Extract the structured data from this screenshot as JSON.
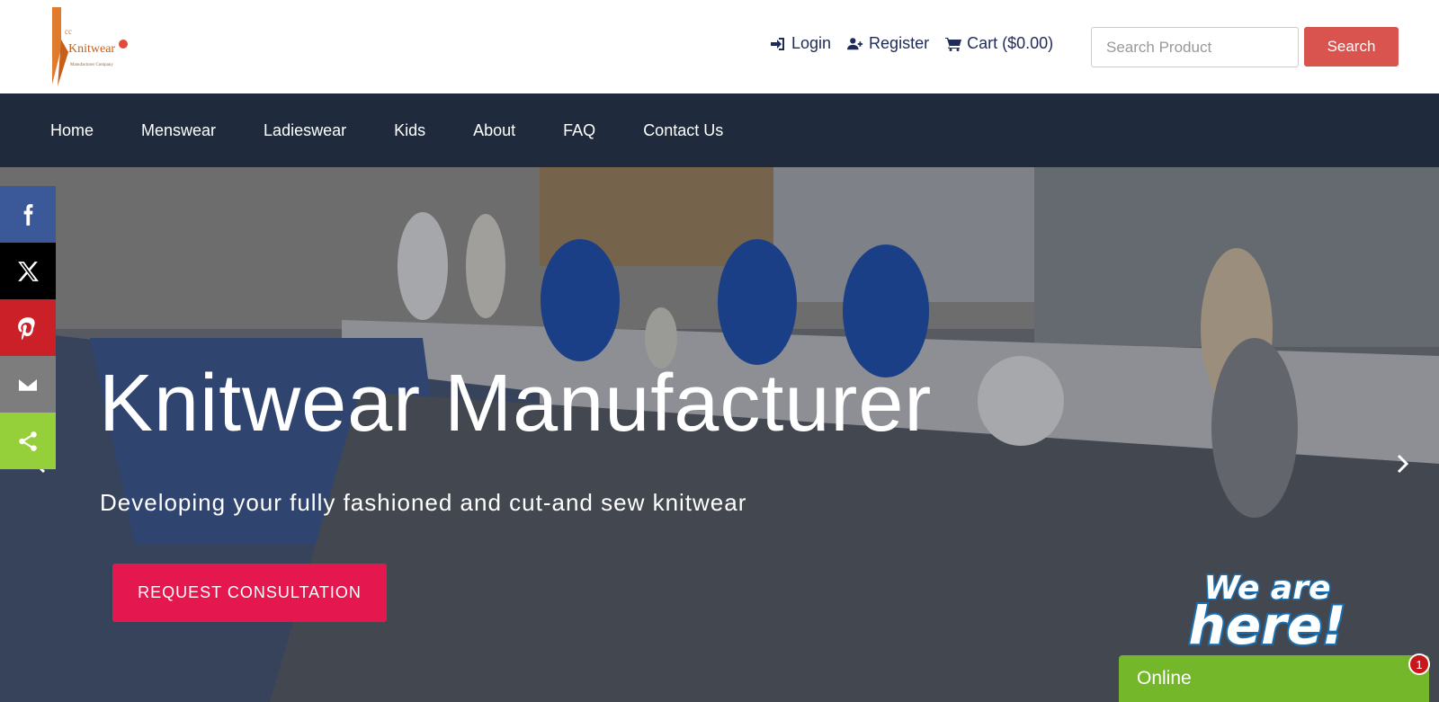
{
  "header": {
    "logo_text": "Knitwear",
    "logo_sub": "Manufacturer Company",
    "logo_initials": "cc",
    "links": [
      {
        "label": "Login",
        "icon": "login-icon"
      },
      {
        "label": "Register",
        "icon": "user-plus-icon"
      },
      {
        "label": "Cart ($0.00)",
        "icon": "cart-icon"
      }
    ],
    "search_placeholder": "Search Product",
    "search_label": "Search"
  },
  "nav": {
    "items": [
      "Home",
      "Menswear",
      "Ladieswear",
      "Kids",
      "About",
      "FAQ",
      "Contact Us"
    ]
  },
  "hero": {
    "title": "Knitwear Manufacturer",
    "subtitle": "Developing your fully fashioned and cut-and sew knitwear",
    "cta_label": "REQUEST CONSULTATION"
  },
  "social": [
    {
      "name": "facebook-icon",
      "color": "#3b5998"
    },
    {
      "name": "x-icon",
      "color": "#000000"
    },
    {
      "name": "pinterest-icon",
      "color": "#cb2027"
    },
    {
      "name": "email-icon",
      "color": "#7d7d7d"
    },
    {
      "name": "share-icon",
      "color": "#95d03a"
    }
  ],
  "chat": {
    "art_line1": "We are",
    "art_line2": "here!",
    "status": "Online",
    "count": "1"
  },
  "colors": {
    "nav_bg": "#1f2b3c",
    "search_btn": "#d9534f",
    "cta": "#e5174f",
    "chat": "#75b72a",
    "link": "#1e2a57"
  }
}
